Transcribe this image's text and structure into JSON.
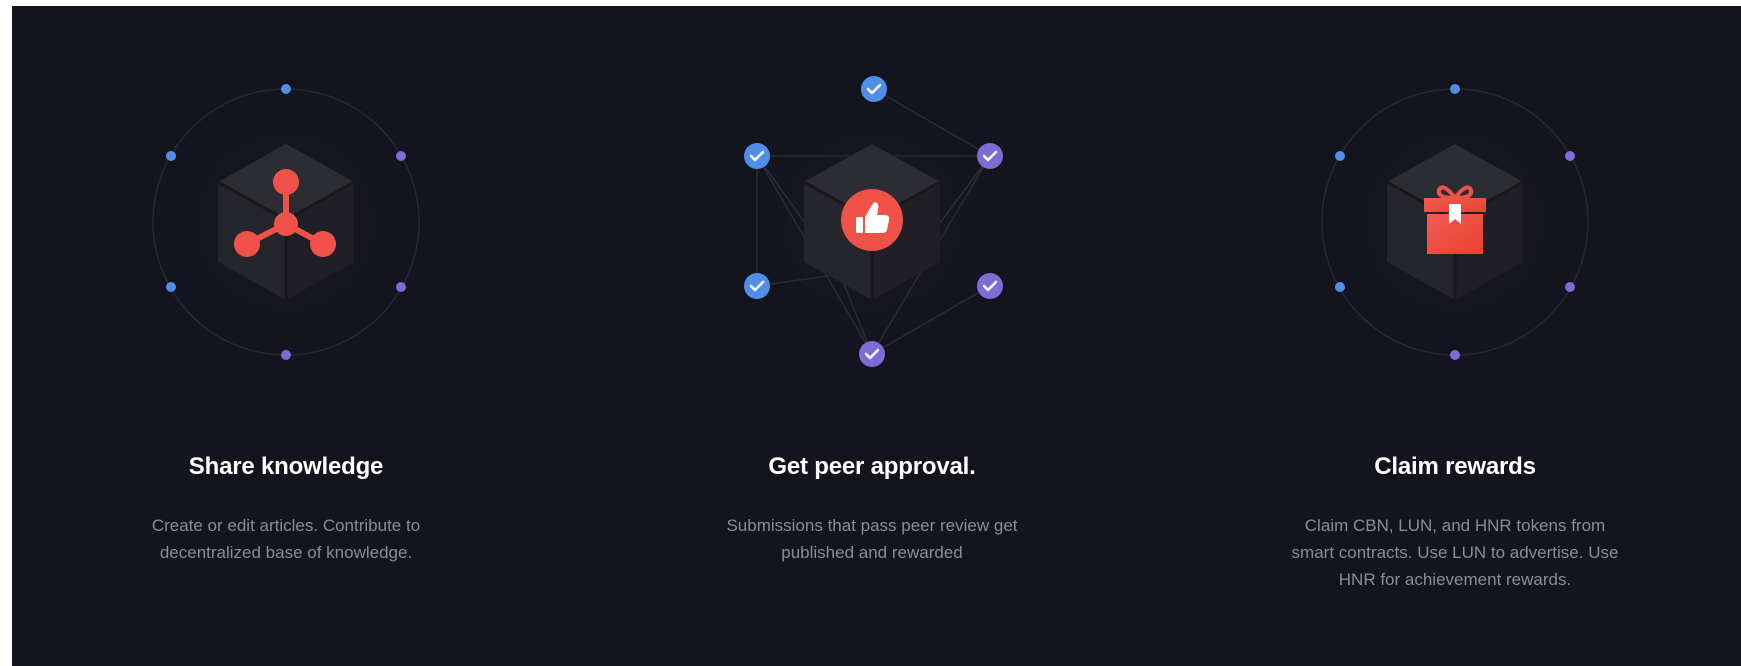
{
  "features": [
    {
      "title": "Share knowledge",
      "description": "Create or edit articles. Contribute to decentralized base of knowledge.",
      "icon": "network-node-icon"
    },
    {
      "title": "Get peer approval.",
      "description": "Submissions that pass peer review get published and rewarded",
      "icon": "thumbs-up-icon"
    },
    {
      "title": "Claim rewards",
      "description": "Claim CBN, LUN, and HNR tokens from smart contracts. Use LUN to advertise. Use HNR for achievement rewards.",
      "icon": "gift-icon"
    }
  ],
  "colors": {
    "background": "#13141d",
    "accent_red": "#f0524a",
    "dot_blue": "#4f8fe8",
    "dot_purple": "#7d6bd6",
    "cube_dark": "#25252c"
  }
}
